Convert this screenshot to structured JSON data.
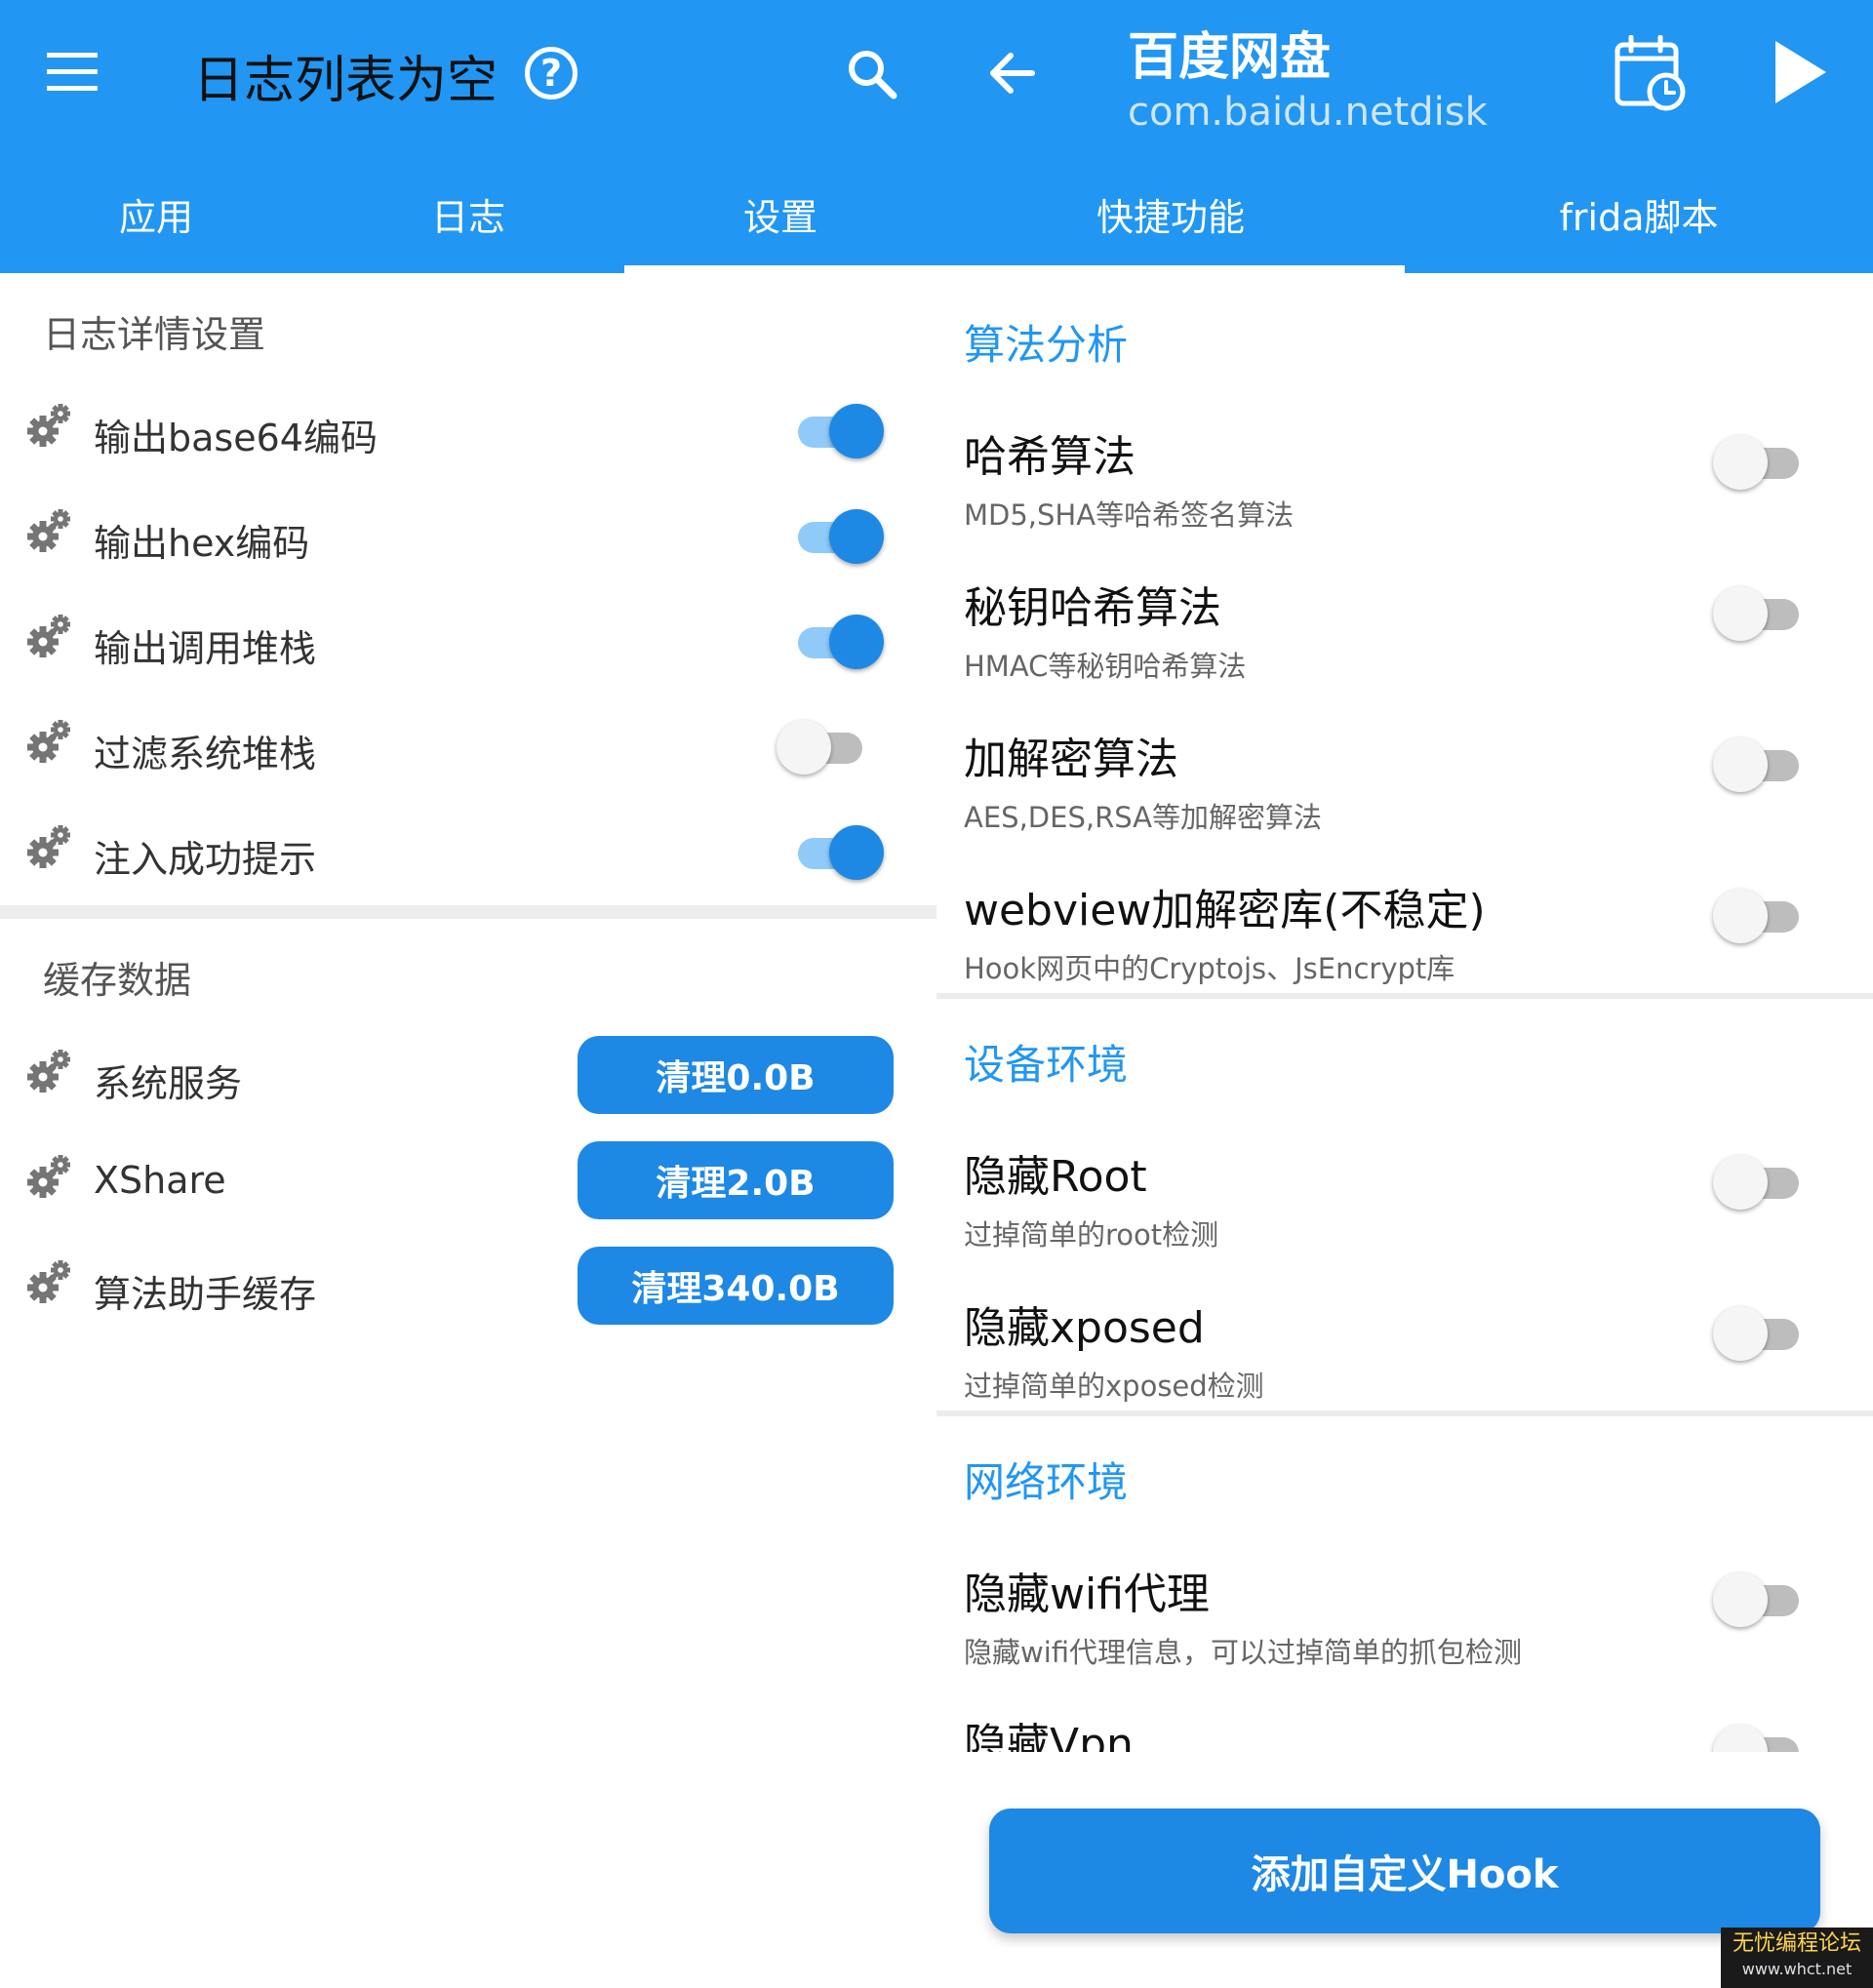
{
  "left": {
    "header": {
      "title": "日志列表为空",
      "menu_icon": "menu-icon",
      "help_icon": "help-icon",
      "search_icon": "search-icon"
    },
    "tabs": [
      {
        "label": "应用"
      },
      {
        "label": "日志"
      },
      {
        "label": "设置",
        "active": true
      }
    ],
    "log_settings": {
      "title": "日志详情设置",
      "items": [
        {
          "label": "输出base64编码",
          "enabled": true
        },
        {
          "label": "输出hex编码",
          "enabled": true
        },
        {
          "label": "输出调用堆栈",
          "enabled": true
        },
        {
          "label": "过滤系统堆栈",
          "enabled": false
        },
        {
          "label": "注入成功提示",
          "enabled": true
        }
      ]
    },
    "cache": {
      "title": "缓存数据",
      "items": [
        {
          "label": "系统服务",
          "button": "清理0.0B"
        },
        {
          "label": "XShare",
          "button": "清理2.0B"
        },
        {
          "label": "算法助手缓存",
          "button": "清理340.0B"
        }
      ]
    }
  },
  "right": {
    "header": {
      "app_name": "百度网盘",
      "package": "com.baidu.netdisk",
      "back_icon": "back-arrow-icon",
      "calendar_icon": "calendar-clock-icon",
      "play_icon": "play-icon"
    },
    "tabs": [
      {
        "label": "快捷功能",
        "active": true
      },
      {
        "label": "frida脚本"
      }
    ],
    "groups": [
      {
        "title": "算法分析",
        "items": [
          {
            "title": "哈希算法",
            "desc": "MD5,SHA等哈希签名算法",
            "enabled": false
          },
          {
            "title": "秘钥哈希算法",
            "desc": "HMAC等秘钥哈希算法",
            "enabled": false
          },
          {
            "title": "加解密算法",
            "desc": "AES,DES,RSA等加解密算法",
            "enabled": false
          },
          {
            "title": "webview加解密库(不稳定)",
            "desc": "Hook网页中的Cryptojs、JsEncrypt库",
            "enabled": false
          }
        ]
      },
      {
        "title": "设备环境",
        "items": [
          {
            "title": "隐藏Root",
            "desc": "过掉简单的root检测",
            "enabled": false
          },
          {
            "title": "隐藏xposed",
            "desc": "过掉简单的xposed检测",
            "enabled": false
          }
        ]
      },
      {
        "title": "网络环境",
        "items": [
          {
            "title": "隐藏wifi代理",
            "desc": "隐藏wifi代理信息，可以过掉简单的抓包检测",
            "enabled": false
          },
          {
            "title": "隐藏Vpn",
            "enabled": false
          }
        ]
      }
    ],
    "fab_label": "添加自定义Hook"
  },
  "colors": {
    "primary": "#2196F3",
    "accent": "#1E88E5",
    "switch_track_on": "#90CAF9",
    "switch_off": "#bdbdbd"
  },
  "watermark": {
    "text": "无忧编程论坛",
    "url": "www.whct.net"
  }
}
